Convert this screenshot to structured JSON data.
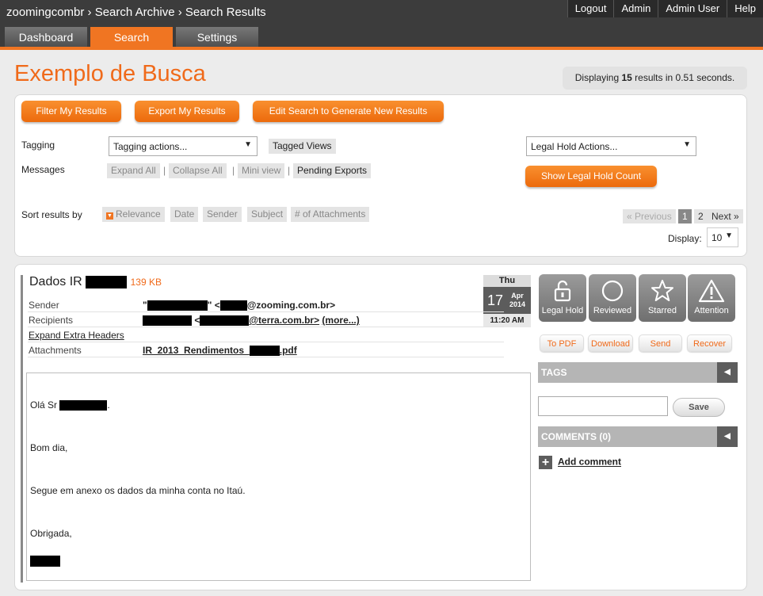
{
  "header": {
    "breadcrumb": "zoomingcombr › Search Archive › Search Results",
    "nav": [
      "Logout",
      "Admin",
      "Admin User",
      "Help"
    ],
    "tabs": [
      {
        "label": "Dashboard",
        "active": false
      },
      {
        "label": "Search",
        "active": true
      },
      {
        "label": "Settings",
        "active": false
      }
    ]
  },
  "page": {
    "title": "Exemplo de Busca",
    "display_info": {
      "prefix": "Displaying ",
      "count": "15",
      "suffix": " results in 0.51 seconds."
    }
  },
  "filters": {
    "buttons": {
      "filter": "Filter My Results",
      "export": "Export My Results",
      "edit": "Edit Search to Generate New Results"
    },
    "tagging": {
      "label": "Tagging",
      "select_value": "Tagging actions...",
      "tagged_views": "Tagged Views"
    },
    "messages": {
      "label": "Messages",
      "expand_all": "Expand All",
      "collapse_all": "Collapse All",
      "mini_view": "Mini view",
      "pending_exports": "Pending Exports",
      "separator": "|"
    },
    "legal_hold": {
      "select_value": "Legal Hold Actions...",
      "count_button": "Show Legal Hold Count"
    },
    "sort": {
      "label": "Sort results by",
      "options": [
        "Relevance",
        "Date",
        "Sender",
        "Subject",
        "# of Attachments"
      ],
      "active": "Relevance"
    },
    "pagination": {
      "previous": "« Previous",
      "pages": [
        "1",
        "2"
      ],
      "current": "1",
      "next": "Next »"
    },
    "display": {
      "label": "Display:",
      "value": "10"
    }
  },
  "message": {
    "subject": "Dados IR",
    "size": "139 KB",
    "date": {
      "dow": "Thu",
      "day": "17",
      "month": "Apr",
      "year": "2014",
      "time": "11:20 AM"
    },
    "sender": {
      "label": "Sender",
      "name_open": "\"",
      "name_close": "\" <",
      "domain": "@zooming.com.br>"
    },
    "recipients": {
      "label": "Recipients",
      "lt": " <",
      "domain": "@terra.com.br>",
      "more": "(more...)"
    },
    "expand_headers": "Expand Extra Headers",
    "attachments": {
      "label": "Attachments",
      "file_prefix": "IR_2013_Rendimentos_",
      "file_suffix": ".pdf"
    },
    "body": {
      "greeting": "Olá Sr",
      "greeting_end": ".",
      "line2": "Bom dia,",
      "line3": "Segue em anexo os dados da minha conta no Itaú.",
      "line4": "Obrigada,"
    }
  },
  "actions": {
    "icons": [
      {
        "label": "Legal Hold",
        "icon": "unlock-icon"
      },
      {
        "label": "Reviewed",
        "icon": "circle-icon"
      },
      {
        "label": "Starred",
        "icon": "star-icon"
      },
      {
        "label": "Attention",
        "icon": "warning-icon"
      }
    ],
    "buttons": [
      "To PDF",
      "Download",
      "Send",
      "Recover"
    ],
    "tags": {
      "title": "TAGS",
      "save": "Save"
    },
    "comments": {
      "title": "COMMENTS (0)",
      "add": "Add comment"
    }
  },
  "colors": {
    "accent": "#f07522",
    "topbar": "#3c3c3c",
    "section": "#b5b5b5"
  }
}
